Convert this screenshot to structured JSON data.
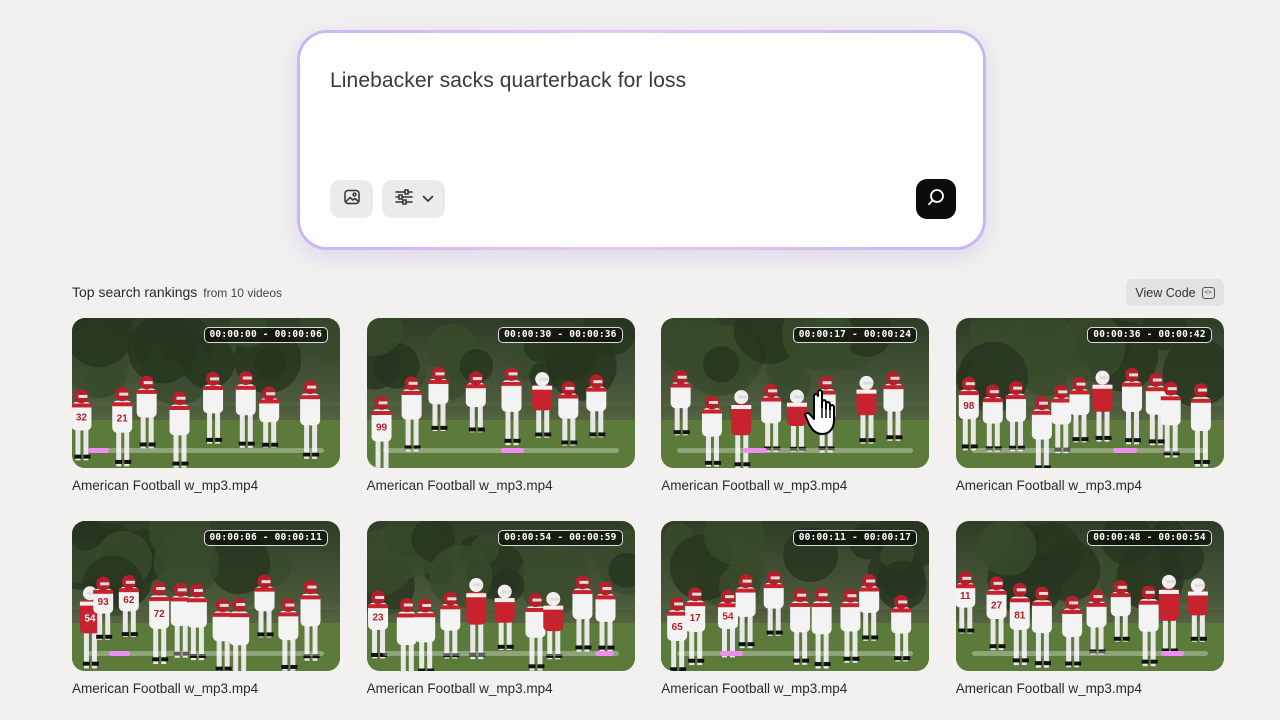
{
  "search": {
    "query": "Linebacker sacks quarterback for loss",
    "image_upload_icon": "image-upload-icon",
    "filters_icon": "sliders-icon",
    "filters_dropdown_icon": "chevron-down-icon",
    "submit_icon": "search-icon"
  },
  "results": {
    "title": "Top search rankings",
    "subtitle": "from 10 videos",
    "view_code_label": "View Code",
    "view_code_icon": "code-icon",
    "items": [
      {
        "filename": "American Football w_mp3.mp4",
        "timestamp": "00:00:00 - 00:00:06",
        "progress_start": 0.0,
        "progress_end": 0.09
      },
      {
        "filename": "American Football w_mp3.mp4",
        "timestamp": "00:00:30 - 00:00:36",
        "progress_start": 0.5,
        "progress_end": 0.6
      },
      {
        "filename": "American Football w_mp3.mp4",
        "timestamp": "00:00:17 - 00:00:24",
        "progress_start": 0.28,
        "progress_end": 0.38
      },
      {
        "filename": "American Football w_mp3.mp4",
        "timestamp": "00:00:36 - 00:00:42",
        "progress_start": 0.6,
        "progress_end": 0.7
      },
      {
        "filename": "American Football w_mp3.mp4",
        "timestamp": "00:00:06 - 00:00:11",
        "progress_start": 0.09,
        "progress_end": 0.18
      },
      {
        "filename": "American Football w_mp3.mp4",
        "timestamp": "00:00:54 - 00:00:59",
        "progress_start": 0.9,
        "progress_end": 0.98
      },
      {
        "filename": "American Football w_mp3.mp4",
        "timestamp": "00:00:11 - 00:00:17",
        "progress_start": 0.18,
        "progress_end": 0.28
      },
      {
        "filename": "American Football w_mp3.mp4",
        "timestamp": "00:00:48 - 00:00:54",
        "progress_start": 0.8,
        "progress_end": 0.9
      }
    ]
  },
  "jerseys": [
    [
      "32",
      "21"
    ],
    [
      "99",
      ""
    ],
    [
      "",
      ""
    ],
    [
      "98",
      ""
    ],
    [
      "54",
      "93",
      "62",
      "72"
    ],
    [
      "23",
      ""
    ],
    [
      "65",
      "17",
      "54"
    ],
    [
      "11",
      "27",
      "81"
    ]
  ],
  "colors": {
    "accent_pink": "#f08df0",
    "glow_lavender": "#c9b4f5",
    "submit_button": "#0c0c0c",
    "jersey_red": "#c7232e",
    "jersey_white": "#f3f3f3"
  }
}
